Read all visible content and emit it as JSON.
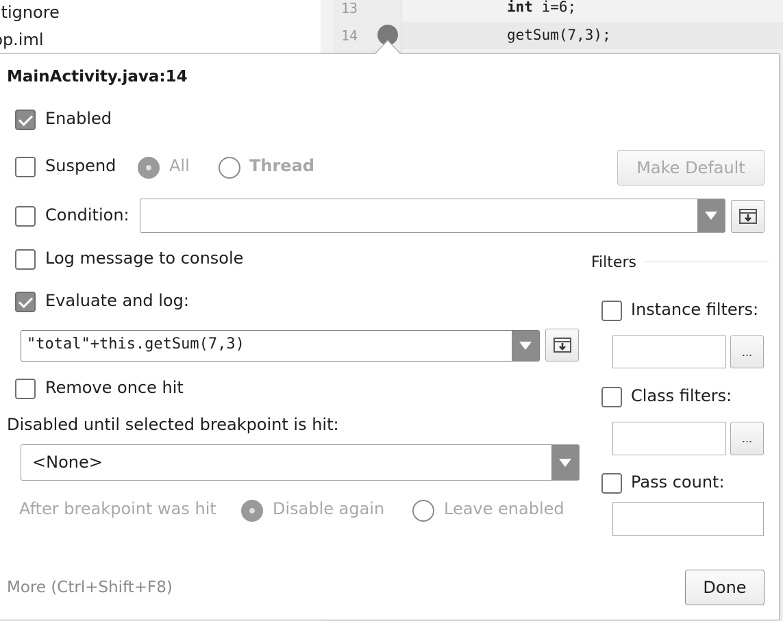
{
  "background": {
    "project_items": [
      ".gitignore",
      "app.iml"
    ],
    "editor": {
      "line_numbers": [
        "13",
        "14"
      ],
      "code_lines": [
        {
          "keyword": "int",
          "rest": " i=6;"
        },
        {
          "keyword": "",
          "rest": "getSum(7,3);"
        }
      ]
    }
  },
  "dialog": {
    "title": "MainActivity.java:14",
    "enabled": {
      "label": "Enabled",
      "checked": true
    },
    "suspend": {
      "label": "Suspend",
      "checked": false
    },
    "suspend_all": {
      "label": "All"
    },
    "suspend_thread": {
      "label": "Thread"
    },
    "make_default_label": "Make Default",
    "condition": {
      "label": "Condition:",
      "value": ""
    },
    "log_message": {
      "label": "Log message to console",
      "checked": false
    },
    "evaluate_log": {
      "label": "Evaluate and log:",
      "checked": true
    },
    "evaluate_expression": "\"total\"+this.getSum(7,3)",
    "remove_once_hit": {
      "label": "Remove once hit",
      "checked": false
    },
    "disabled_until_label": "Disabled until selected breakpoint is hit:",
    "disabled_until_value": "<None>",
    "after_hit_label": "After breakpoint was hit",
    "disable_again_label": "Disable again",
    "leave_enabled_label": "Leave enabled",
    "filters_heading": "Filters",
    "instance_filters": {
      "label": "Instance filters:",
      "value": ""
    },
    "class_filters": {
      "label": "Class filters:",
      "value": ""
    },
    "pass_count": {
      "label": "Pass count:",
      "value": ""
    },
    "ellipsis_label": "...",
    "more_link": "More (Ctrl+Shift+F8)",
    "done_label": "Done"
  }
}
